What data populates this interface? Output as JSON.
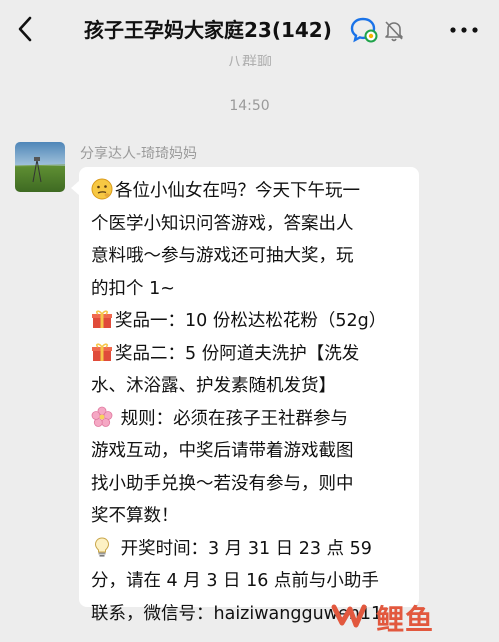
{
  "header": {
    "title": "孩子王孕妈大家庭23(142)",
    "subtitle_cut": "八群聊",
    "back_icon": "chevron-left-icon",
    "chat_icon": "group-chat-icon",
    "mute_icon": "bell-off-icon",
    "more_icon": "more-dots-icon"
  },
  "chat": {
    "timestamp": "14:50",
    "message": {
      "sender": "分享达人-琦琦妈妈",
      "lines": [
        "各位小仙女在吗？今天下午玩一",
        "个医学小知识问答游戏，答案出人",
        "意料哦～参与游戏还可抽大奖，玩",
        "的扣个 1~",
        "奖品一：10 份松达松花粉（52g）",
        "奖品二：5 份阿道夫洗护【洗发",
        "水、沐浴露、护发素随机发货】",
        " 规则：必须在孩子王社群参与",
        "游戏互动，中奖后请带着游戏截图",
        "找小助手兑换～若没有参与，则中",
        "奖不算数！",
        " 开奖时间：3 月 31 日 23 点 59",
        "分，请在 4 月 3 日 16 点前与小助手",
        "联系，微信号：haiziwangguwen11"
      ]
    }
  },
  "watermark": {
    "text": "鲤鱼",
    "color": "#e2583e"
  },
  "colors": {
    "background": "#ededed",
    "bubble": "#ffffff",
    "meta_text": "#9a9a9a"
  }
}
